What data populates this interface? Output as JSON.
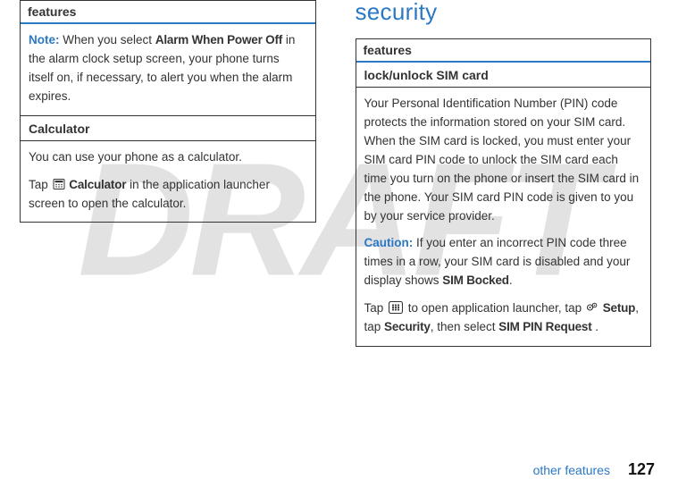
{
  "watermark": "DRAFT",
  "left": {
    "header": "features",
    "note_label": "Note:",
    "note_text": " When you select ",
    "note_bold1": "Alarm When Power Off",
    "note_text2": " in the alarm clock setup screen, your phone turns itself on, if necessary, to alert you when the alarm expires.",
    "calc_head": "Calculator",
    "calc_p1": "You can use your phone as a calculator.",
    "calc_p2a": "Tap ",
    "calc_bold": "Calculator",
    "calc_p2b": " in the application launcher screen to open the calculator."
  },
  "right": {
    "heading": "security",
    "header": "features",
    "sub": "lock/unlock SIM card",
    "p1": "Your Personal Identification Number (PIN) code protects the information stored on your SIM card. When the SIM card is locked, you must enter your SIM card PIN code to unlock the SIM card each time you turn on the phone or insert the SIM card in the phone. Your SIM card PIN code is given to you by your service provider.",
    "caution_label": "Caution:",
    "caution_text1": " If you enter an incorrect PIN code three times in a row, your SIM card is disabled and your display shows ",
    "caution_bold": "SIM Bocked",
    "caution_text2": ".",
    "p3a": "Tap ",
    "p3b": " to open application launcher, tap ",
    "p3_bold1": "Setup",
    "p3c": ", tap ",
    "p3_bold2": "Security",
    "p3d": ", then select ",
    "p3_bold3": "SIM PIN Request",
    "p3e": " ."
  },
  "footer": {
    "text": "other features",
    "page": "127"
  }
}
